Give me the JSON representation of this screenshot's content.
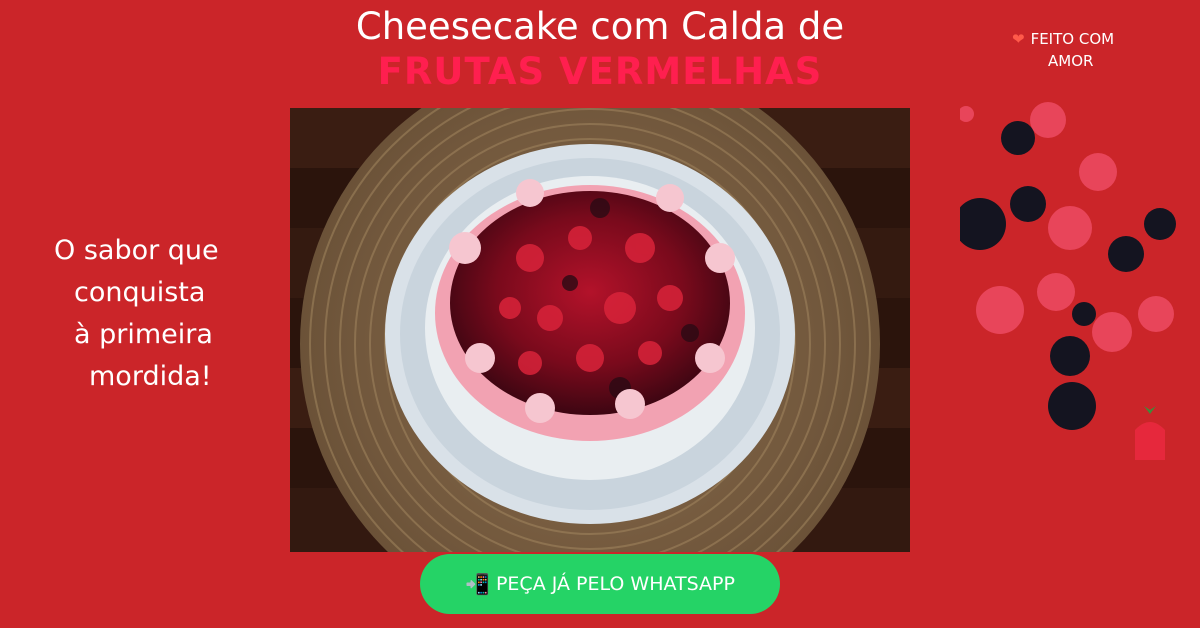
{
  "title": {
    "line1": "Cheesecake com Calda de",
    "line2": "FRUTAS VERMELHAS"
  },
  "badge": {
    "icon": "heart-icon",
    "line1": "FEITO COM",
    "line2": "AMOR"
  },
  "slogan": {
    "lines": [
      "O sabor que",
      "conquista",
      "à primeira",
      "mordida!"
    ]
  },
  "cta": {
    "icon": "mobile-phone-arrow-icon",
    "label": "PEÇA JÁ PELO WHATSAPP"
  },
  "colors": {
    "background": "#cb2529",
    "accent_title": "#ff1f4f",
    "cta": "#25d366"
  }
}
